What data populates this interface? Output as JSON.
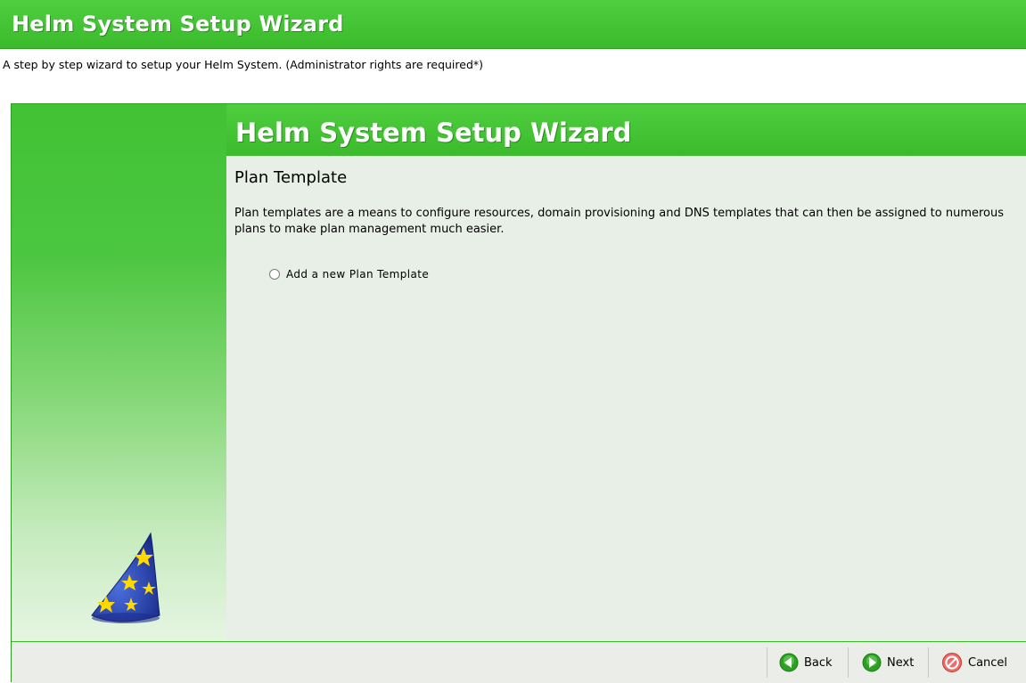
{
  "window": {
    "title": "Helm System Setup Wizard",
    "subtitle": "A step by step wizard to setup your Helm System. (Administrator rights are required*)"
  },
  "wizard": {
    "header_title": "Helm System Setup Wizard",
    "section_title": "Plan Template",
    "description": "Plan templates are a means to configure resources, domain provisioning and DNS templates that can then be assigned to numerous plans to make plan management much easier.",
    "option_label": "Add a new Plan Template"
  },
  "buttons": {
    "back_label": "Back",
    "next_label": "Next",
    "cancel_label": "Cancel"
  },
  "icons": {
    "wizard_hat": "wizard-hat-icon",
    "back": "back-arrow-icon",
    "next": "next-arrow-icon",
    "cancel": "cancel-icon"
  },
  "colors": {
    "accent_green": "#3bba2c",
    "content_bg": "#e8efe6"
  }
}
